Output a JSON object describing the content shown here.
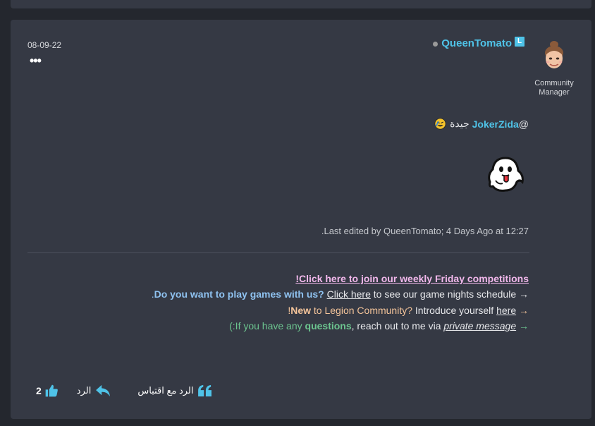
{
  "post": {
    "date": "08-09-22",
    "more_label": "•••",
    "author": {
      "name": "QueenTomato",
      "rank_badge": "L",
      "role_line1": "Community",
      "role_line2": "Manager"
    },
    "mention": {
      "at": "@",
      "name": "JokerZida",
      "text": "جيدة"
    },
    "edited_note": ".Last edited by QueenTomato; 4 Days Ago at 12:27"
  },
  "signature": {
    "line1": "!Click here to join our weekly Friday competitions",
    "line2": {
      "prefix": ".",
      "bold": "Do you want to play games with us?",
      "link": "Click here",
      "rest": "to see our game nights schedule",
      "arrow": "→"
    },
    "line3": {
      "excl": "!",
      "bold": "New",
      "mid": "to Legion Community?",
      "rest": "Introduce yourself",
      "link": "here",
      "arrow": "→"
    },
    "line4": {
      "start": "(:If you have any",
      "bold": "questions",
      "mid": ", reach out to me via",
      "link": "private message",
      "arrow": "→"
    }
  },
  "actions": {
    "like_count": "2",
    "reply_label": "الرد",
    "quote_label": "الرد مع اقتباس"
  },
  "colors": {
    "accent": "#4fc3e8",
    "card_bg": "#353944",
    "page_bg": "#24272e",
    "sig_pink": "#f2b8ec"
  },
  "icons": [
    "status-dot-icon",
    "rank-badge-icon",
    "avatar-icon",
    "emoji-icon",
    "ghost-emoji-icon",
    "thumbs-up-icon",
    "reply-arrow-icon",
    "quote-icon"
  ]
}
